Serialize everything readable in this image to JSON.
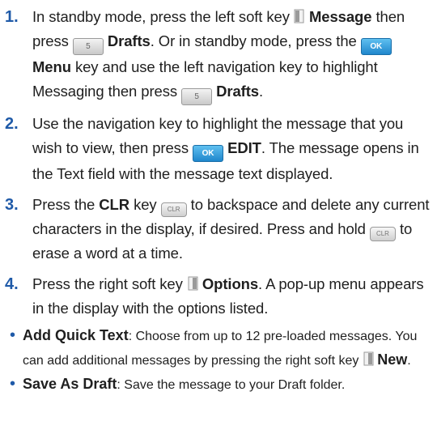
{
  "steps": [
    {
      "number": "1.",
      "a": "In standby mode, press the left soft key",
      "b": "Message",
      "c": "then press",
      "d": "Drafts",
      "e": ". Or in standby mode, press the",
      "f": "Menu",
      "g": "key and use the left navigation key to highlight Messaging then press",
      "h": "Drafts",
      "i": "."
    },
    {
      "number": "2.",
      "a": "Use the navigation key to highlight the message that you wish to view, then press",
      "b": "EDIT",
      "c": ". The message opens in the Text field with the message text displayed."
    },
    {
      "number": "3.",
      "a": "Press the",
      "b": "CLR",
      "c": "key",
      "d": "to backspace and delete any current characters in the display, if desired. Press and hold",
      "e": "to erase a word at a time."
    },
    {
      "number": "4.",
      "a": "Press the right soft key",
      "b": "Options",
      "c": ". A pop-up menu appears in the display with the options listed."
    }
  ],
  "bullets": [
    {
      "title": "Add Quick Text",
      "a": ": Choose from up to 12 pre-loaded messages. You can add additional messages by pressing the right soft key",
      "b": "New",
      "c": "."
    },
    {
      "title": "Save As Draft",
      "a": ": Save the message to your Draft folder."
    }
  ],
  "keys": {
    "ok_label": "OK",
    "five_label": "5",
    "clr_label": "CLR"
  },
  "colors": {
    "accent": "#1f5aa8",
    "ok_key": "#2a95d8"
  }
}
